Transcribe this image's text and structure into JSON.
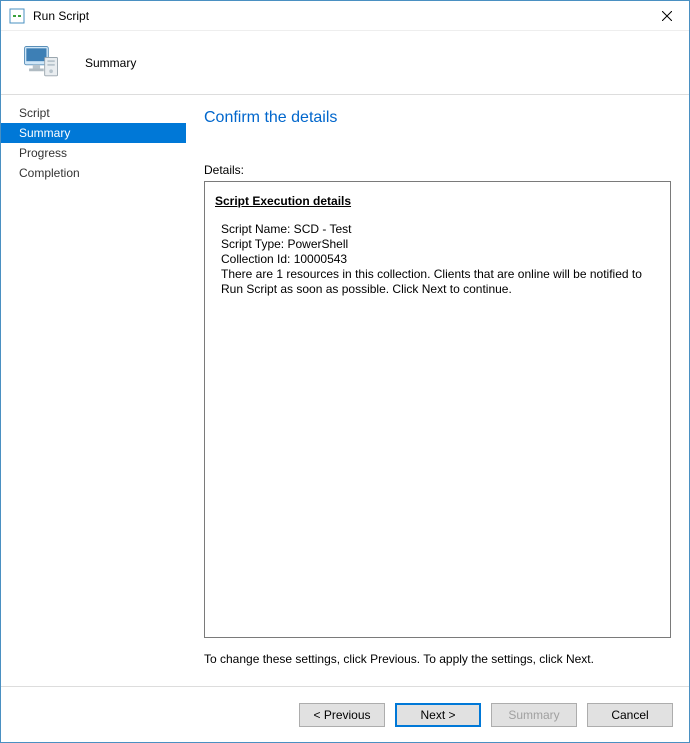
{
  "window": {
    "title": "Run Script"
  },
  "header": {
    "title": "Summary"
  },
  "sidebar": {
    "items": [
      {
        "label": "Script",
        "active": false
      },
      {
        "label": "Summary",
        "active": true
      },
      {
        "label": "Progress",
        "active": false
      },
      {
        "label": "Completion",
        "active": false
      }
    ]
  },
  "content": {
    "heading": "Confirm the details",
    "details_label": "Details:",
    "details_heading": "Script Execution details",
    "script_name_line": "Script Name: SCD - Test",
    "script_type_line": "Script Type: PowerShell",
    "collection_id_line": "Collection Id: 10000543",
    "notice_line": "There are 1 resources in this collection. Clients that are online will be notified to Run Script as soon as possible. Click Next to continue.",
    "hint_text": "To change these settings, click Previous. To apply the settings, click Next."
  },
  "footer": {
    "previous_label": "< Previous",
    "next_label": "Next >",
    "summary_label": "Summary",
    "cancel_label": "Cancel"
  }
}
